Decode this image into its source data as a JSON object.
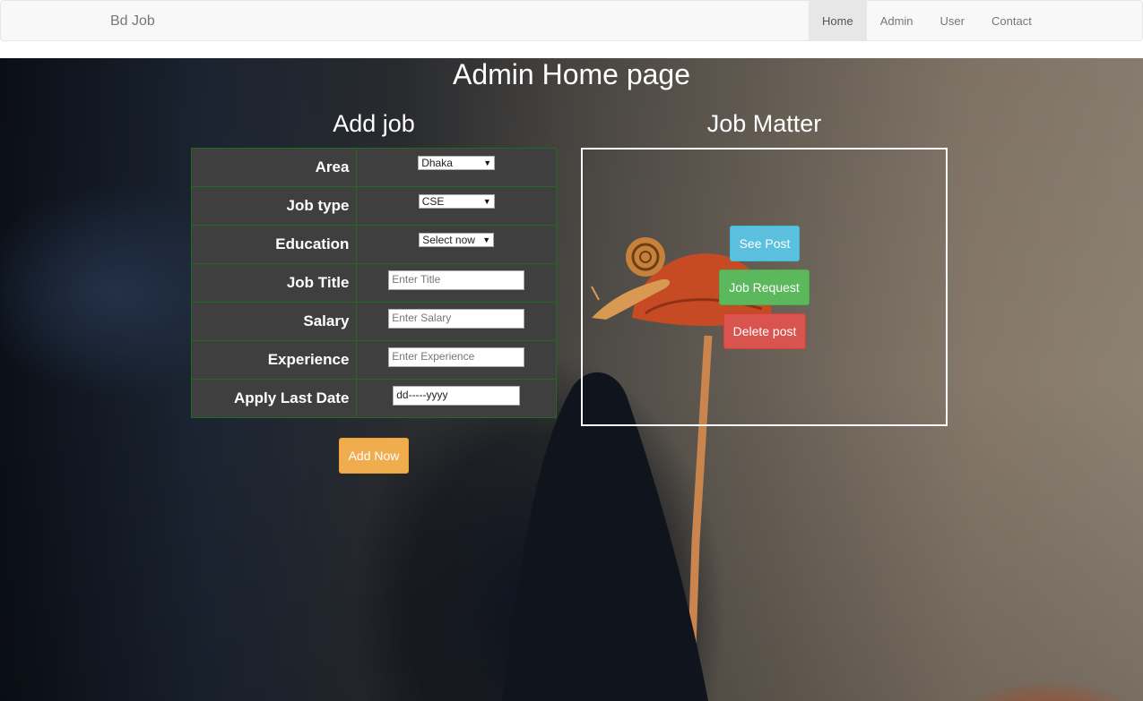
{
  "navbar": {
    "brand": "Bd Job",
    "items": [
      {
        "label": "Home",
        "active": true
      },
      {
        "label": "Admin",
        "active": false
      },
      {
        "label": "User",
        "active": false
      },
      {
        "label": "Contact",
        "active": false
      }
    ]
  },
  "page": {
    "title": "Admin Home page",
    "add_job_title": "Add job",
    "job_matter_title": "Job Matter"
  },
  "form": {
    "area": {
      "label": "Area",
      "value": "Dhaka"
    },
    "job_type": {
      "label": "Job type",
      "value": "CSE"
    },
    "education": {
      "label": "Education",
      "value": "Select now"
    },
    "job_title": {
      "label": "Job Title",
      "placeholder": "Enter Title"
    },
    "salary": {
      "label": "Salary",
      "placeholder": "Enter Salary"
    },
    "experience": {
      "label": "Experience",
      "placeholder": "Enter Experience"
    },
    "apply_last_date": {
      "label": "Apply Last Date",
      "value": "dd-----yyyy"
    },
    "submit_label": "Add Now"
  },
  "job_matter": {
    "see_post": "See Post",
    "job_request": "Job Request",
    "delete_post": "Delete post"
  },
  "colors": {
    "warning": "#f0ad4e",
    "info": "#5bc0de",
    "success": "#5cb85c",
    "danger": "#d9534f",
    "table_bg": "#3f3f3f",
    "table_border": "#1f6b1f"
  }
}
